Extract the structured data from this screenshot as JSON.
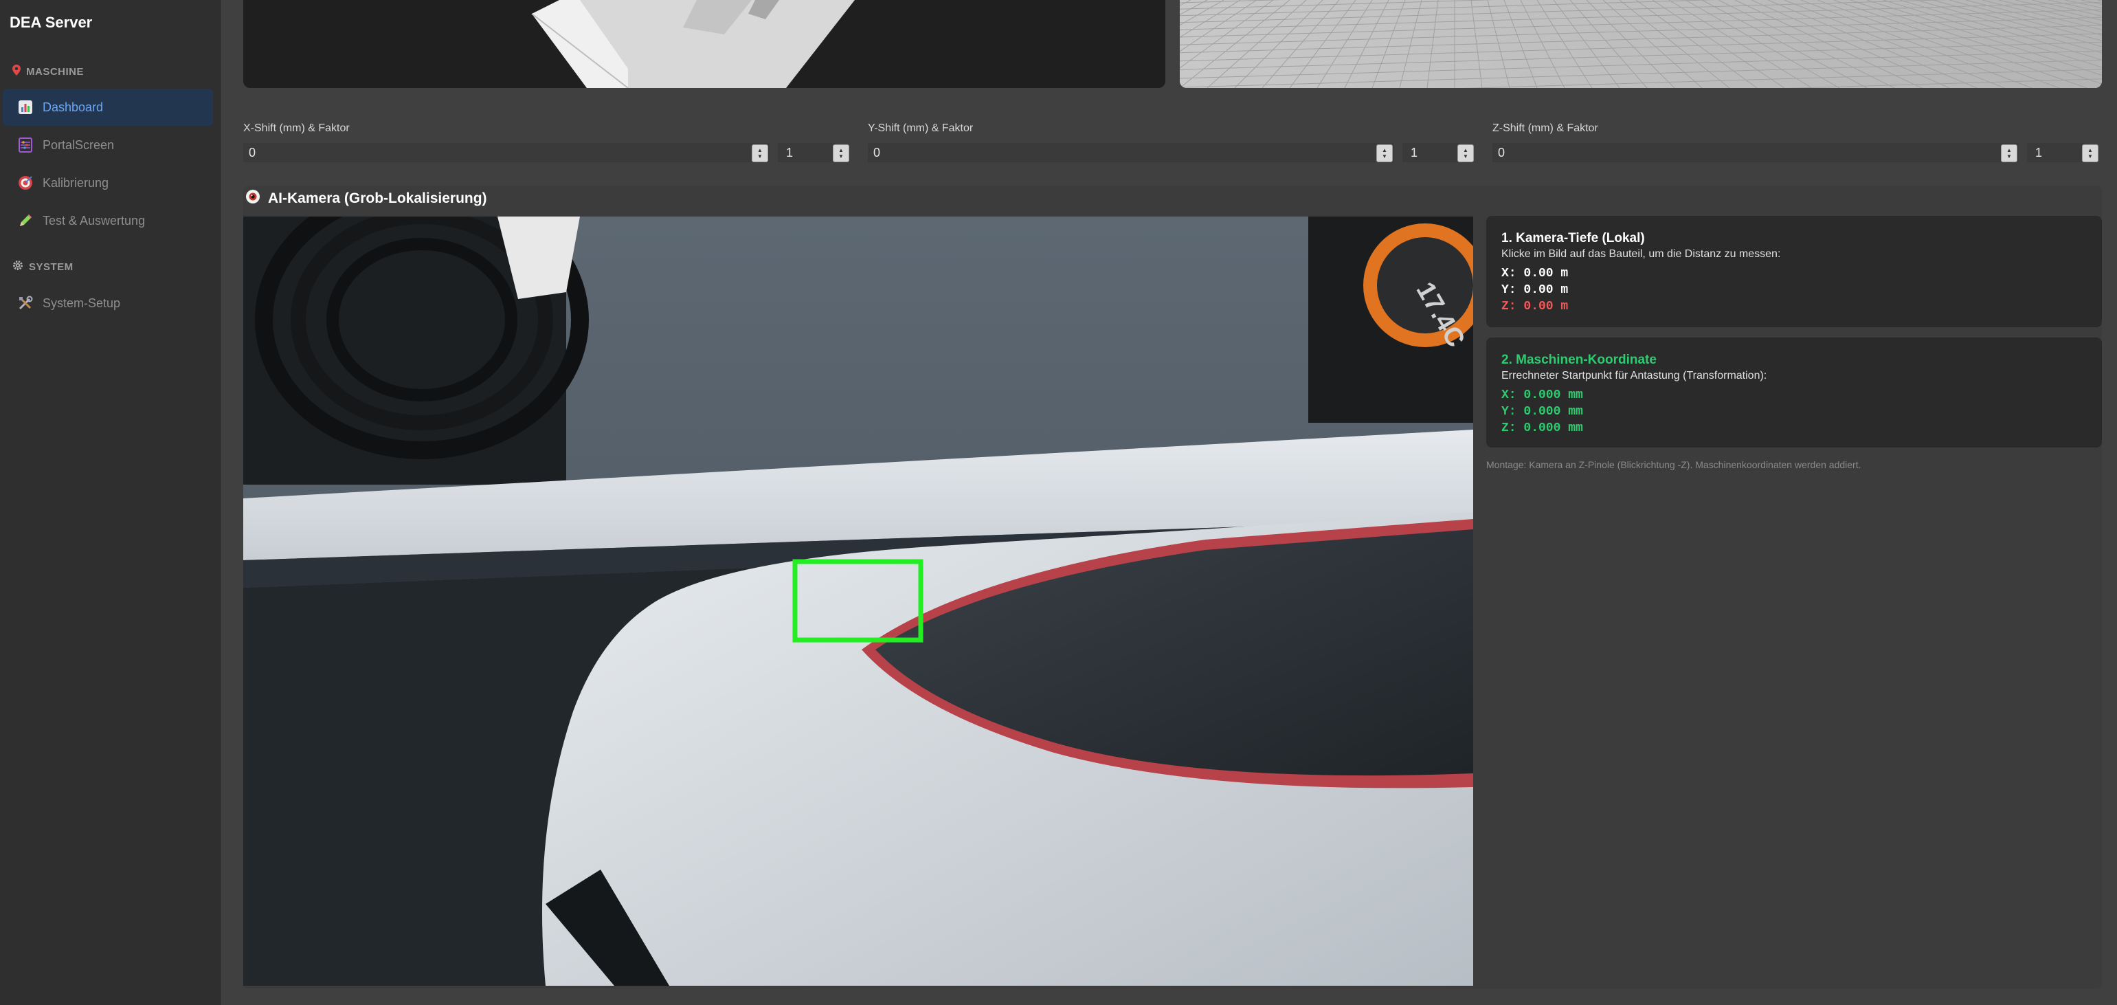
{
  "app": {
    "title": "DEA Server"
  },
  "sidebar": {
    "sections": [
      {
        "label": "MASCHINE",
        "icon": "pin-icon"
      },
      {
        "label": "SYSTEM",
        "icon": "gear-icon"
      }
    ],
    "items": [
      {
        "label": "Dashboard",
        "icon": "chart-icon",
        "active": true
      },
      {
        "label": "PortalScreen",
        "icon": "abacus-icon",
        "active": false
      },
      {
        "label": "Kalibrierung",
        "icon": "target-icon",
        "active": false
      },
      {
        "label": "Test & Auswertung",
        "icon": "pencil-icon",
        "active": false
      },
      {
        "label": "System-Setup",
        "icon": "tools-icon",
        "active": false
      }
    ]
  },
  "shifts": [
    {
      "label": "X-Shift (mm) & Faktor",
      "value": "0",
      "factor": "1"
    },
    {
      "label": "Y-Shift (mm) & Faktor",
      "value": "0",
      "factor": "1"
    },
    {
      "label": "Z-Shift (mm) & Faktor",
      "value": "0",
      "factor": "1"
    }
  ],
  "camera": {
    "title": "AI-Kamera (Grob-Lokalisierung)",
    "title_icon": "eye-icon",
    "overlay_label": "17.4C"
  },
  "depth_card": {
    "title": "1. Kamera-Tiefe (Lokal)",
    "description": "Klicke im Bild auf das Bauteil, um die Distanz zu messen:",
    "x": "X: 0.00 m",
    "y": "Y: 0.00 m",
    "z": "Z: 0.00 m"
  },
  "machine_card": {
    "title": "2. Maschinen-Koordinate",
    "description": "Errechneter Startpunkt für Antastung (Transformation):",
    "x": "X: 0.000 mm",
    "y": "Y: 0.000 mm",
    "z": "Z: 0.000 mm"
  },
  "footnote": "Montage: Kamera an Z-Pinole (Blickrichtung -Z). Maschinenkoordinaten werden addiert.",
  "colors": {
    "accent": "#6aa6f5",
    "active_bg": "#22364f",
    "green": "#2ecc71",
    "red": "#f05a5a",
    "detection_box": "#22ee22"
  }
}
